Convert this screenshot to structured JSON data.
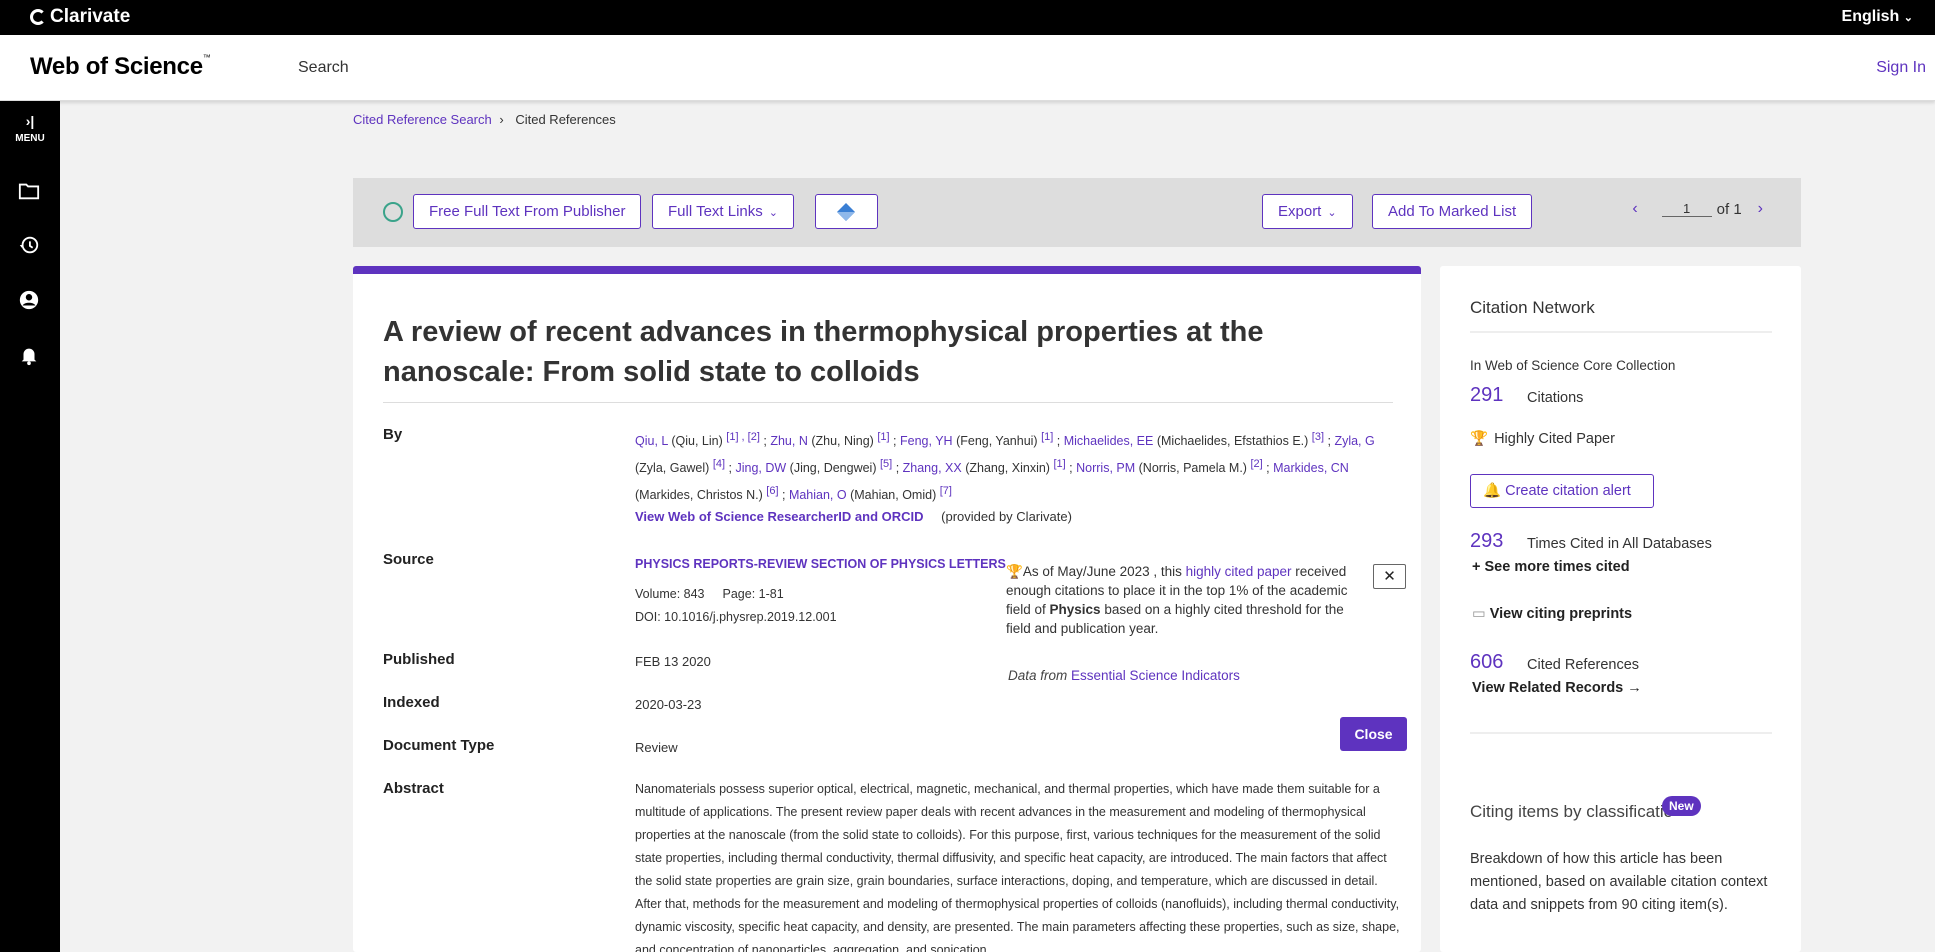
{
  "topbar": {
    "brand": "Clarivate",
    "language": "English"
  },
  "header": {
    "brand": "Web of Science",
    "tm": "™",
    "search": "Search",
    "signin": "Sign In"
  },
  "rail": {
    "menu_label": "MENU"
  },
  "breadcrumb": {
    "parent": "Cited Reference Search",
    "current": "Cited References"
  },
  "toolbar": {
    "free_full_text": "Free Full Text From Publisher",
    "full_text_links": "Full Text Links",
    "export": "Export",
    "add_marked": "Add To Marked List",
    "page": "1",
    "of": "of 1"
  },
  "record": {
    "title": "A review of recent advances in thermophysical properties at the nanoscale: From solid state to colloids",
    "labels": {
      "by": "By",
      "source": "Source",
      "published": "Published",
      "indexed": "Indexed",
      "document_type": "Document Type",
      "abstract": "Abstract"
    },
    "authors": [
      {
        "short": "Qiu, L",
        "full": "(Qiu, Lin)",
        "refs": "[1] , [2]"
      },
      {
        "short": "Zhu, N",
        "full": "(Zhu, Ning)",
        "refs": "[1]"
      },
      {
        "short": "Feng, YH",
        "full": "(Feng, Yanhui)",
        "refs": "[1]"
      },
      {
        "short": "Michaelides, EE",
        "full": "(Michaelides, Efstathios E.)",
        "refs": "[3]"
      },
      {
        "short": "Zyla, G",
        "full": "(Zyla, Gawel)",
        "refs": "[4]"
      },
      {
        "short": "Jing, DW",
        "full": "(Jing, Dengwei)",
        "refs": "[5]"
      },
      {
        "short": "Zhang, XX",
        "full": "(Zhang, Xinxin)",
        "refs": "[1]"
      },
      {
        "short": "Norris, PM",
        "full": "(Norris, Pamela M.)",
        "refs": "[2]"
      },
      {
        "short": "Markides, CN",
        "full": "(Markides, Christos N.)",
        "refs": "[6]"
      },
      {
        "short": "Mahian, O",
        "full": "(Mahian, Omid)",
        "refs": "[7]"
      }
    ],
    "orcid_link": "View Web of Science ResearcherID and ORCID",
    "orcid_provider": "(provided by Clarivate)",
    "journal": "PHYSICS REPORTS-REVIEW SECTION OF PHYSICS LETTERS",
    "volume": "Volume: 843",
    "pages": "Page: 1-81",
    "doi": "DOI: 10.1016/j.physrep.2019.12.001",
    "published": "FEB 13 2020",
    "indexed": "2020-03-23",
    "document_type": "Review",
    "close_label": "Close",
    "highly_cited_notice": {
      "prefix": "As of May/June 2023 , this ",
      "link": "highly cited paper",
      "middle": " received enough citations to place it in the top 1% of the academic field of ",
      "field": "Physics",
      "suffix": " based on a highly cited threshold for the field and publication year.",
      "close": "✕",
      "data_from": "Data from ",
      "esi": "Essential Science Indicators"
    },
    "abstract": "Nanomaterials possess superior optical, electrical, magnetic, mechanical, and thermal properties, which have made them suitable for a multitude of applications. The present review paper deals with recent advances in the measurement and modeling of thermophysical properties at the nanoscale (from the solid state to colloids). For this purpose, first, various techniques for the measurement of the solid state properties, including thermal conductivity, thermal diffusivity, and specific heat capacity, are introduced. The main factors that affect the solid state properties are grain size, grain boundaries, surface interactions, doping, and temperature, which are discussed in detail. After that, methods for the measurement and modeling of thermophysical properties of colloids (nanofluids), including thermal conductivity, dynamic viscosity, specific heat capacity, and density, are presented. The main parameters affecting these properties, such as size, shape, and concentration of nanoparticles, aggregation, and sonication"
  },
  "citation_network": {
    "heading": "Citation Network",
    "collection": "In Web of Science Core Collection",
    "citations": "291",
    "citations_label": "Citations",
    "highly_cited": "Highly Cited Paper",
    "create_alert": "Create citation alert",
    "times_cited": "293",
    "times_cited_label": "Times Cited in All Databases",
    "see_more": "+ See more times cited",
    "preprints": "View citing preprints",
    "cited_refs": "606",
    "cited_refs_label": "Cited References",
    "related": "View Related Records →",
    "citing_heading": "Citing items by classificatio",
    "new_badge": "New",
    "citing_desc": "Breakdown of how this article has been mentioned, based on available citation context data and snippets from 90 citing item(s)."
  },
  "colors": {
    "accent": "#5e33bf",
    "trophy": "#b3261e"
  }
}
